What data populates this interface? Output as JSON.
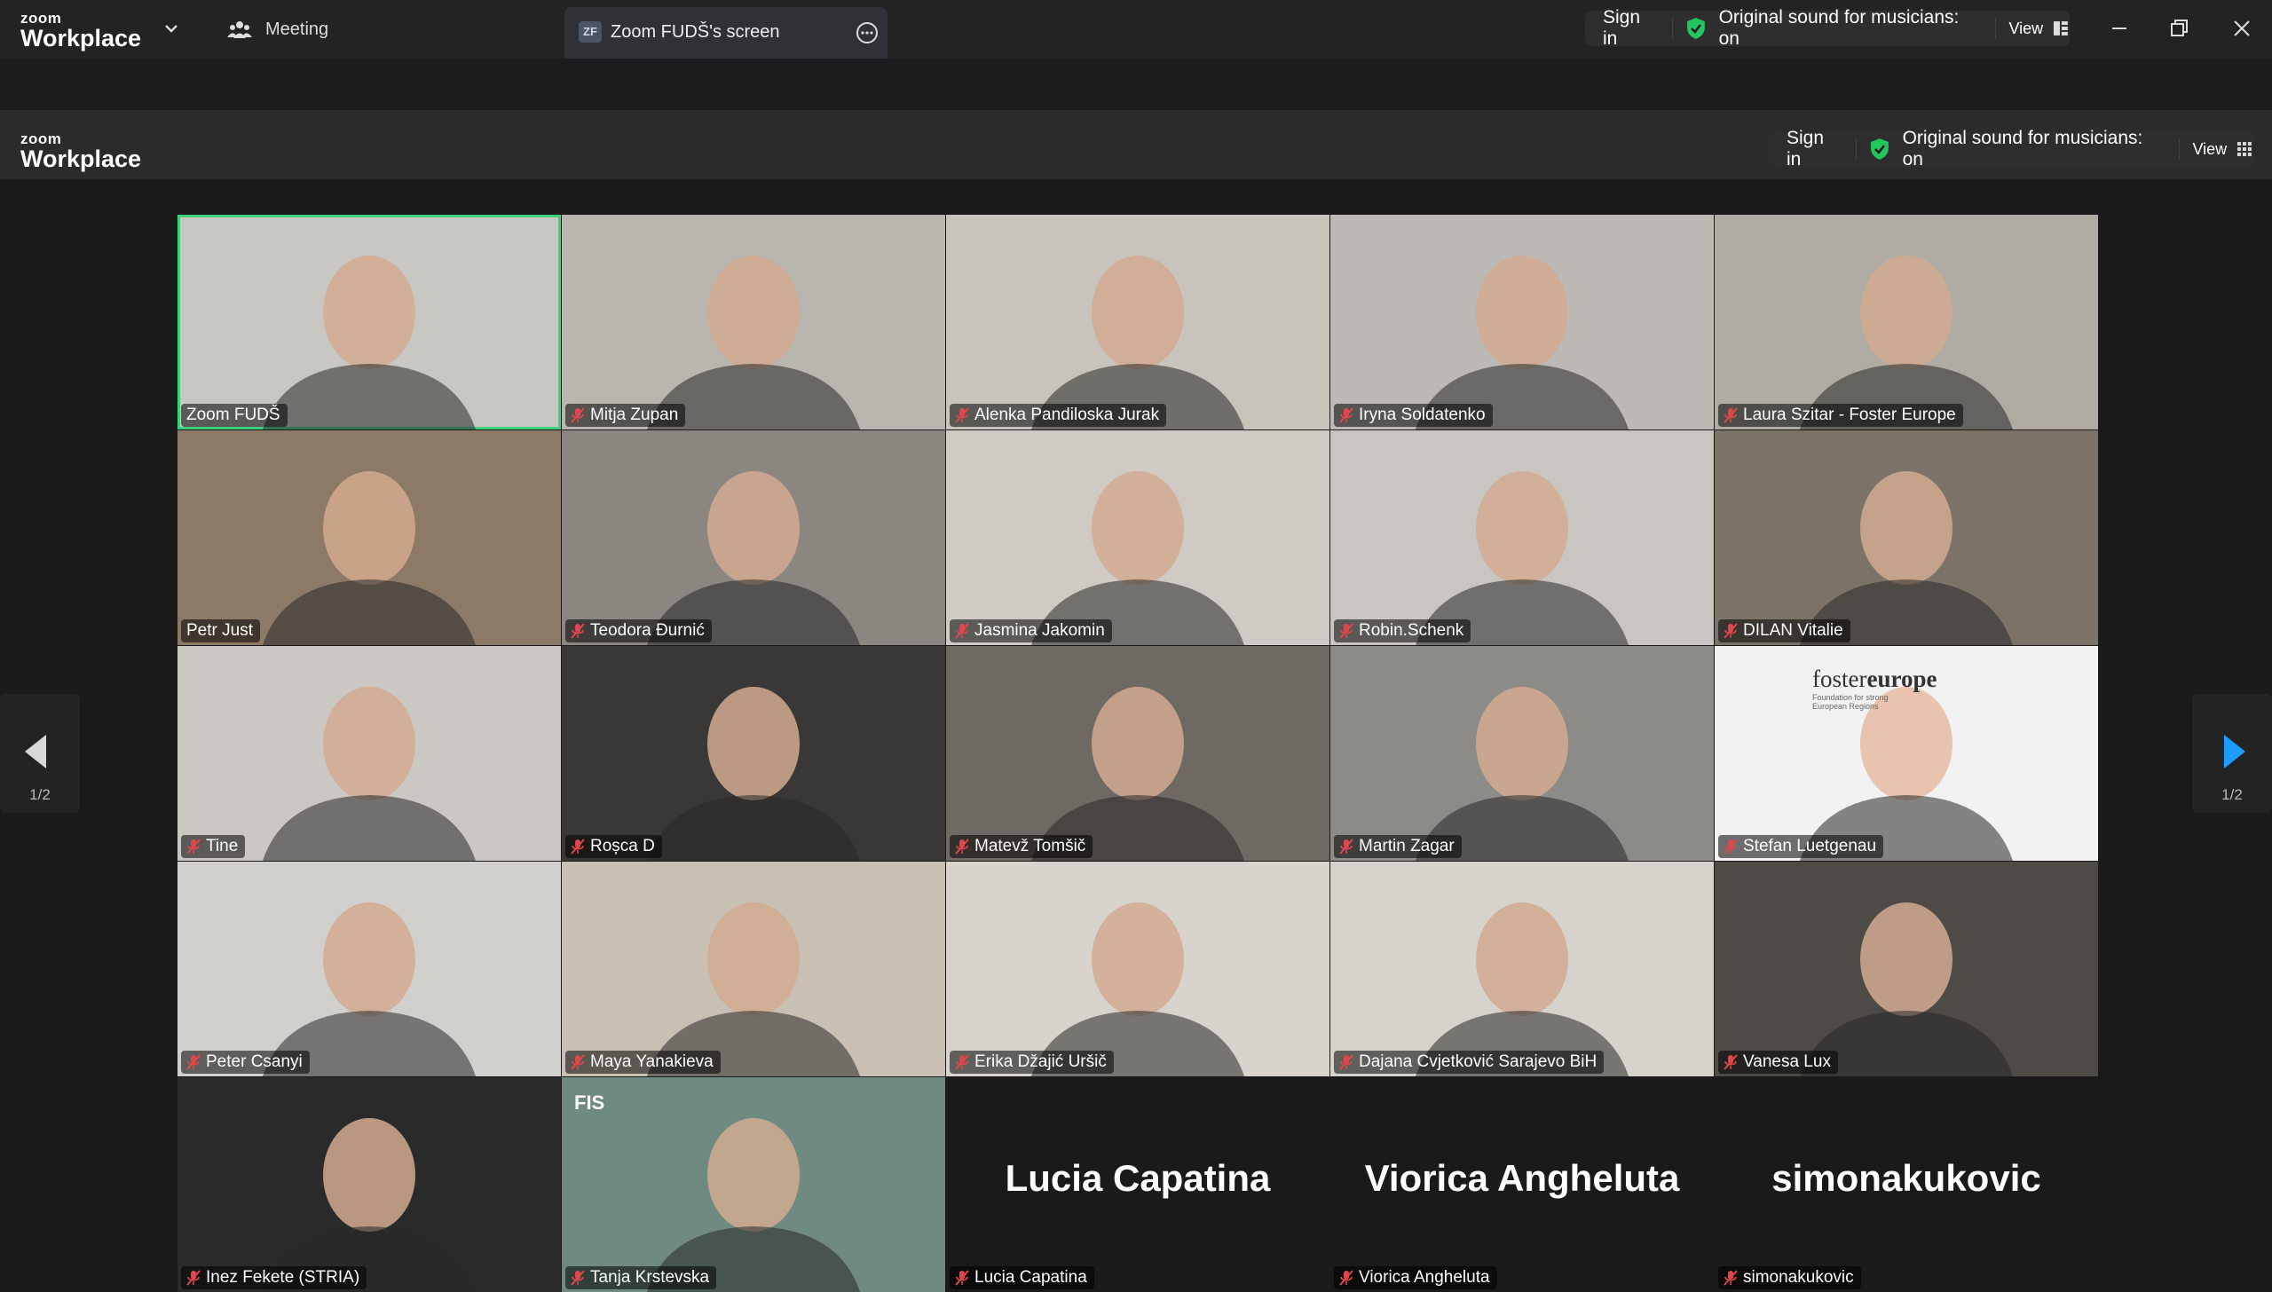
{
  "app": {
    "logo_small": "zoom",
    "logo_big": "Workplace"
  },
  "tabs": {
    "meeting": "Meeting",
    "share_badge": "ZF",
    "share": "Zoom FUDŠ's screen"
  },
  "toolbar": {
    "sign_in": "Sign in",
    "sound": "Original sound for musicians: on",
    "view": "View"
  },
  "nav": {
    "page": "1/2"
  },
  "colors": {
    "active_border": "#3fd07e",
    "shield": "#22c55e",
    "mic_muted": "#e0464b",
    "next_arrow": "#1e9bff"
  },
  "participants": [
    {
      "name": "Zoom FUDŠ",
      "muted": false,
      "active": true,
      "bg": "#c9c7c2"
    },
    {
      "name": "Mitja Zupan",
      "muted": true,
      "bg": "#b9b6b0"
    },
    {
      "name": "Alenka Pandiloska Jurak",
      "muted": true,
      "bg": "#c8c3bb"
    },
    {
      "name": "Iryna Soldatenko",
      "muted": true,
      "bg": "#bdbab6"
    },
    {
      "name": "Laura Szitar - Foster Europe",
      "muted": true,
      "bg": "#b0aca4"
    },
    {
      "name": "Petr Just",
      "muted": false,
      "bg": "#8d7a66"
    },
    {
      "name": "Teodora Đurnić",
      "muted": true,
      "bg": "#8b8680"
    },
    {
      "name": "Jasmina Jakomin",
      "muted": true,
      "bg": "#cfcac4"
    },
    {
      "name": "Robin.Schenk",
      "muted": true,
      "bg": "#c9c6c2"
    },
    {
      "name": "DILAN Vitalie",
      "muted": true,
      "bg": "#7c7368"
    },
    {
      "name": "Tine",
      "muted": true,
      "bg": "#cbc8c3"
    },
    {
      "name": "Roșca D",
      "muted": true,
      "bg": "#3a3836"
    },
    {
      "name": "Matevž Tomšič",
      "muted": true,
      "bg": "#6f6963"
    },
    {
      "name": "Martin Zagar",
      "muted": true,
      "bg": "#8d8b87"
    },
    {
      "name": "Stefan Luetgenau",
      "muted": true,
      "bg": "#f2f2f2"
    },
    {
      "name": "Peter Csanyi",
      "muted": true,
      "bg": "#d2d0cd"
    },
    {
      "name": "Maya Yanakieva",
      "muted": true,
      "bg": "#c9c0b4"
    },
    {
      "name": "Erika Džajić Uršič",
      "muted": true,
      "bg": "#d8d3cc"
    },
    {
      "name": "Dajana Cvjetković Sarajevo BiH",
      "muted": true,
      "bg": "#d6d2cc"
    },
    {
      "name": "Vanesa Lux",
      "muted": true,
      "bg": "#4e4a46"
    },
    {
      "name": "Inez Fekete (STRIA)",
      "muted": true,
      "bg": "#2a2a2a"
    },
    {
      "name": "Tanja Krstevska",
      "muted": true,
      "bg": "#6f8a80"
    },
    {
      "name": "Lucia Capatina",
      "muted": true,
      "bg": "#1a1a1a",
      "avatar": true
    },
    {
      "name": "Viorica Angheluta",
      "muted": true,
      "bg": "#1a1a1a",
      "avatar": true
    },
    {
      "name": "simonakukovic",
      "muted": true,
      "bg": "#1a1a1a",
      "avatar": true
    }
  ],
  "foster_logo": {
    "brand_a": "foster",
    "brand_b": "europe",
    "tagline_1": "Foundation for strong",
    "tagline_2": "European Regions"
  },
  "fis_logo": {
    "text": "FIS"
  },
  "icons": [
    "chevron-down-icon",
    "meeting-icon",
    "more-icon",
    "shield-check-icon",
    "grid-icon",
    "minimize-icon",
    "restore-icon",
    "close-icon",
    "mic-muted-icon",
    "prev-arrow-icon",
    "next-arrow-icon"
  ]
}
